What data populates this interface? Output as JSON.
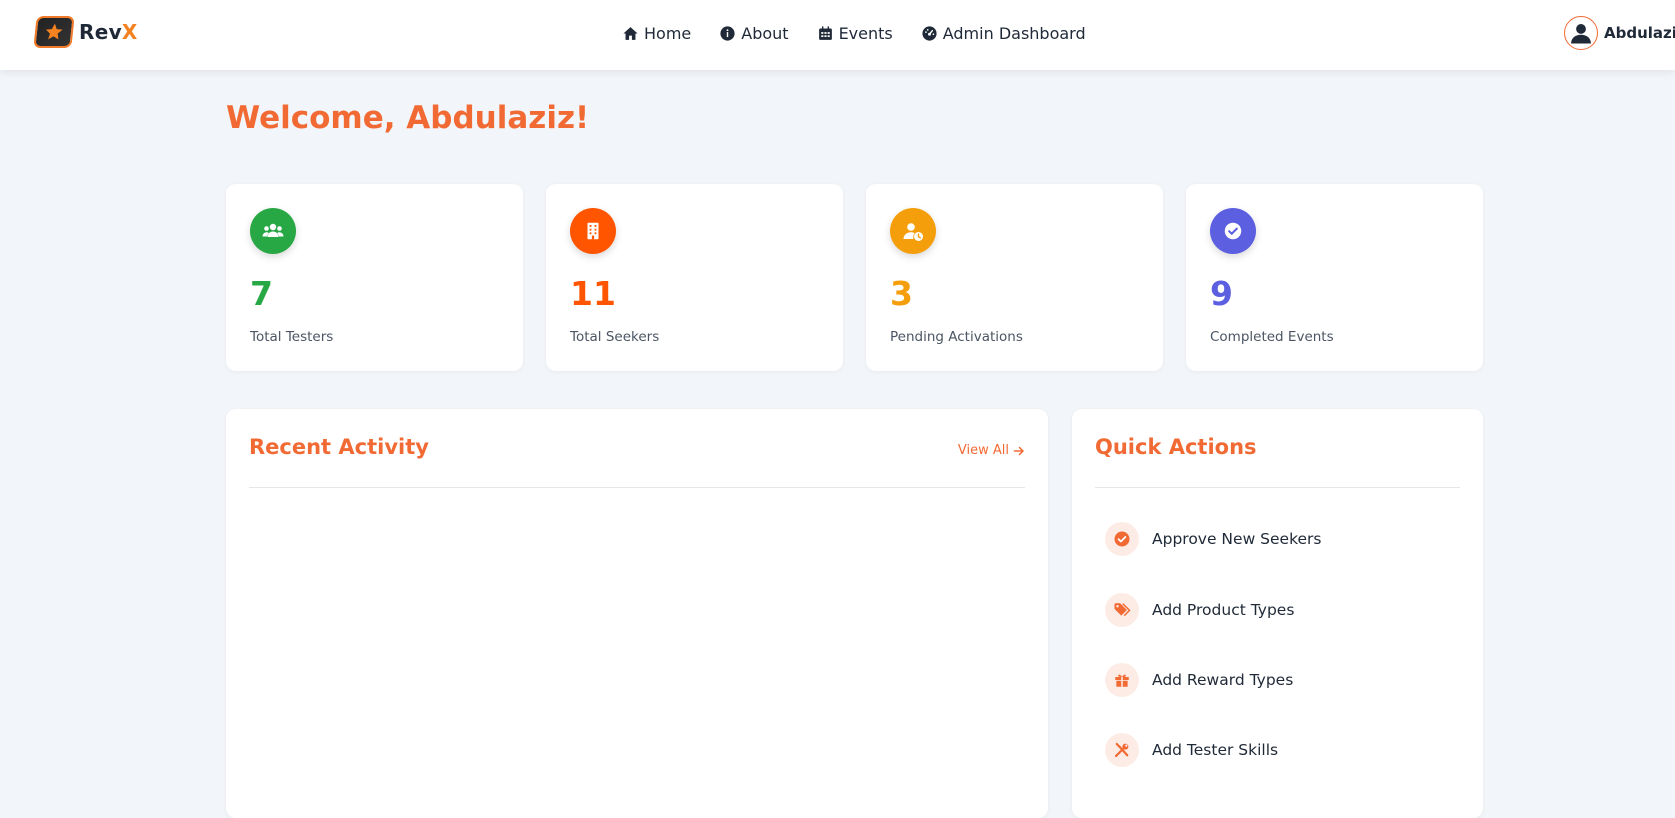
{
  "header": {
    "brand_prefix": "Rev",
    "brand_accent": "X",
    "nav": [
      {
        "label": "Home",
        "icon": "home-icon"
      },
      {
        "label": "About",
        "icon": "info-circle-icon"
      },
      {
        "label": "Events",
        "icon": "calendar-icon"
      },
      {
        "label": "Admin Dashboard",
        "icon": "dashboard-gauge-icon"
      }
    ],
    "user_name": "Abdulaziz"
  },
  "welcome": "Welcome, Abdulaziz!",
  "stats": [
    {
      "value": "7",
      "label": "Total Testers",
      "color": "#28a745",
      "icon": "users-icon"
    },
    {
      "value": "11",
      "label": "Total Seekers",
      "color": "#ff5500",
      "icon": "building-icon"
    },
    {
      "value": "3",
      "label": "Pending Activations",
      "color": "#f59e0b",
      "icon": "user-clock-icon"
    },
    {
      "value": "9",
      "label": "Completed Events",
      "color": "#5b5fe0",
      "icon": "check-circle-icon"
    }
  ],
  "recent_activity": {
    "title": "Recent Activity",
    "view_all": "View All"
  },
  "quick_actions": {
    "title": "Quick Actions",
    "items": [
      {
        "label": "Approve New Seekers",
        "icon": "check-circle-icon"
      },
      {
        "label": "Add Product Types",
        "icon": "tags-icon"
      },
      {
        "label": "Add Reward Types",
        "icon": "gift-icon"
      },
      {
        "label": "Add Tester Skills",
        "icon": "tools-icon"
      }
    ]
  },
  "colors": {
    "accent": "#f26a33",
    "background": "#f2f5f9"
  }
}
